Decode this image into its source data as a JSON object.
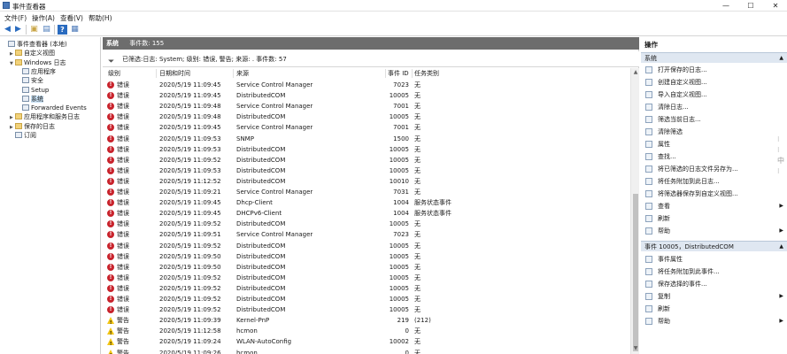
{
  "window": {
    "title": "事件查看器",
    "controls": {
      "minimize": "—",
      "maximize": "☐",
      "close": "✕"
    }
  },
  "menu": [
    "文件(F)",
    "操作(A)",
    "查看(V)",
    "帮助(H)"
  ],
  "toolbar": [
    "back-arrow-icon",
    "forward-arrow-icon",
    "up-folder-icon",
    "console-tree-icon",
    "help-icon",
    "properties-icon"
  ],
  "tree": [
    {
      "label": "事件查看器 (本地)",
      "indent": 0,
      "twisty": "",
      "icon": "computer"
    },
    {
      "label": "自定义视图",
      "indent": 1,
      "twisty": ">",
      "icon": "folder"
    },
    {
      "label": "Windows 日志",
      "indent": 1,
      "twisty": "v",
      "icon": "folder"
    },
    {
      "label": "应用程序",
      "indent": 2,
      "twisty": "",
      "icon": "log"
    },
    {
      "label": "安全",
      "indent": 2,
      "twisty": "",
      "icon": "log"
    },
    {
      "label": "Setup",
      "indent": 2,
      "twisty": "",
      "icon": "log"
    },
    {
      "label": "系统",
      "indent": 2,
      "twisty": "",
      "icon": "log",
      "selected": true
    },
    {
      "label": "Forwarded Events",
      "indent": 2,
      "twisty": "",
      "icon": "log"
    },
    {
      "label": "应用程序和服务日志",
      "indent": 1,
      "twisty": ">",
      "icon": "folder"
    },
    {
      "label": "保存的日志",
      "indent": 1,
      "twisty": ">",
      "icon": "folder"
    },
    {
      "label": "订阅",
      "indent": 1,
      "twisty": "",
      "icon": "log"
    }
  ],
  "center": {
    "log_name": "系统",
    "event_count": "事件数: 155",
    "filter_text": "已筛选:日志: System; 级别: 错误, 警告; 来源: . 事件数: 57",
    "columns": [
      "级别",
      "日期和时间",
      "来源",
      "事件 ID",
      "任务类别"
    ],
    "rows": [
      {
        "level": "错误",
        "type": "error",
        "datetime": "2020/5/19 11:09:45",
        "source": "Service Control Manager",
        "event_id": "7023",
        "task": "无"
      },
      {
        "level": "错误",
        "type": "error",
        "datetime": "2020/5/19 11:09:45",
        "source": "DistributedCOM",
        "event_id": "10005",
        "task": "无"
      },
      {
        "level": "错误",
        "type": "error",
        "datetime": "2020/5/19 11:09:48",
        "source": "Service Control Manager",
        "event_id": "7001",
        "task": "无"
      },
      {
        "level": "错误",
        "type": "error",
        "datetime": "2020/5/19 11:09:48",
        "source": "DistributedCOM",
        "event_id": "10005",
        "task": "无"
      },
      {
        "level": "错误",
        "type": "error",
        "datetime": "2020/5/19 11:09:45",
        "source": "Service Control Manager",
        "event_id": "7001",
        "task": "无"
      },
      {
        "level": "错误",
        "type": "error",
        "datetime": "2020/5/19 11:09:53",
        "source": "SNMP",
        "event_id": "1500",
        "task": "无"
      },
      {
        "level": "错误",
        "type": "error",
        "datetime": "2020/5/19 11:09:53",
        "source": "DistributedCOM",
        "event_id": "10005",
        "task": "无"
      },
      {
        "level": "错误",
        "type": "error",
        "datetime": "2020/5/19 11:09:52",
        "source": "DistributedCOM",
        "event_id": "10005",
        "task": "无"
      },
      {
        "level": "错误",
        "type": "error",
        "datetime": "2020/5/19 11:09:53",
        "source": "DistributedCOM",
        "event_id": "10005",
        "task": "无"
      },
      {
        "level": "错误",
        "type": "error",
        "datetime": "2020/5/19 11:12:52",
        "source": "DistributedCOM",
        "event_id": "10010",
        "task": "无"
      },
      {
        "level": "错误",
        "type": "error",
        "datetime": "2020/5/19 11:09:21",
        "source": "Service Control Manager",
        "event_id": "7031",
        "task": "无"
      },
      {
        "level": "错误",
        "type": "error",
        "datetime": "2020/5/19 11:09:45",
        "source": "Dhcp-Client",
        "event_id": "1004",
        "task": "服务状态事件"
      },
      {
        "level": "错误",
        "type": "error",
        "datetime": "2020/5/19 11:09:45",
        "source": "DHCPv6-Client",
        "event_id": "1004",
        "task": "服务状态事件"
      },
      {
        "level": "错误",
        "type": "error",
        "datetime": "2020/5/19 11:09:52",
        "source": "DistributedCOM",
        "event_id": "10005",
        "task": "无"
      },
      {
        "level": "错误",
        "type": "error",
        "datetime": "2020/5/19 11:09:51",
        "source": "Service Control Manager",
        "event_id": "7023",
        "task": "无"
      },
      {
        "level": "错误",
        "type": "error",
        "datetime": "2020/5/19 11:09:52",
        "source": "DistributedCOM",
        "event_id": "10005",
        "task": "无"
      },
      {
        "level": "错误",
        "type": "error",
        "datetime": "2020/5/19 11:09:50",
        "source": "DistributedCOM",
        "event_id": "10005",
        "task": "无"
      },
      {
        "level": "错误",
        "type": "error",
        "datetime": "2020/5/19 11:09:50",
        "source": "DistributedCOM",
        "event_id": "10005",
        "task": "无"
      },
      {
        "level": "错误",
        "type": "error",
        "datetime": "2020/5/19 11:09:52",
        "source": "DistributedCOM",
        "event_id": "10005",
        "task": "无"
      },
      {
        "level": "错误",
        "type": "error",
        "datetime": "2020/5/19 11:09:52",
        "source": "DistributedCOM",
        "event_id": "10005",
        "task": "无"
      },
      {
        "level": "错误",
        "type": "error",
        "datetime": "2020/5/19 11:09:52",
        "source": "DistributedCOM",
        "event_id": "10005",
        "task": "无"
      },
      {
        "level": "错误",
        "type": "error",
        "datetime": "2020/5/19 11:09:52",
        "source": "DistributedCOM",
        "event_id": "10005",
        "task": "无"
      },
      {
        "level": "警告",
        "type": "warning",
        "datetime": "2020/5/19 11:09:39",
        "source": "Kernel-PnP",
        "event_id": "219",
        "task": "(212)"
      },
      {
        "level": "警告",
        "type": "warning",
        "datetime": "2020/5/19 11:12:58",
        "source": "hcmon",
        "event_id": "0",
        "task": "无"
      },
      {
        "level": "警告",
        "type": "warning",
        "datetime": "2020/5/19 11:09:24",
        "source": "WLAN-AutoConfig",
        "event_id": "10002",
        "task": "无"
      },
      {
        "level": "警告",
        "type": "warning",
        "datetime": "2020/5/19 11:09:26",
        "source": "hcmon",
        "event_id": "0",
        "task": "无"
      }
    ]
  },
  "actions": {
    "title": "操作",
    "section1": "系统",
    "section1_items": [
      {
        "label": "打开保存的日志...",
        "icon": "open-log-icon"
      },
      {
        "label": "创建自定义视图...",
        "icon": "filter-create-icon"
      },
      {
        "label": "导入自定义视图...",
        "icon": "import-icon"
      },
      {
        "label": "清除日志...",
        "icon": "clear-log-icon"
      },
      {
        "label": "筛选当前日志...",
        "icon": "filter-icon"
      },
      {
        "label": "清除筛选",
        "icon": "clear-filter-icon"
      },
      {
        "label": "属性",
        "icon": "properties-icon"
      },
      {
        "label": "查找...",
        "icon": "find-icon"
      },
      {
        "label": "将已筛选的日志文件另存为...",
        "icon": "save-icon"
      },
      {
        "label": "将任务附加到此日志...",
        "icon": "attach-task-icon"
      },
      {
        "label": "将筛选器保存到自定义视图...",
        "icon": "save-filter-icon"
      },
      {
        "label": "查看",
        "icon": "view-icon",
        "submenu": true
      },
      {
        "label": "刷新",
        "icon": "refresh-icon"
      },
      {
        "label": "帮助",
        "icon": "help-icon",
        "submenu": true
      }
    ],
    "section2": "事件 10005，DistributedCOM",
    "section2_items": [
      {
        "label": "事件属性",
        "icon": "event-properties-icon"
      },
      {
        "label": "将任务附加到此事件...",
        "icon": "attach-task-icon"
      },
      {
        "label": "保存选择的事件...",
        "icon": "save-icon"
      },
      {
        "label": "复制",
        "icon": "copy-icon",
        "submenu": true
      },
      {
        "label": "刷新",
        "icon": "refresh-icon"
      },
      {
        "label": "帮助",
        "icon": "help-icon",
        "submenu": true
      }
    ]
  },
  "colors": {
    "header_gray": "#6d6d6d",
    "section_blue": "#dfe7f1",
    "error_red": "#c8232c",
    "warning_yellow": "#f3c614",
    "selection": "#cce4f7"
  }
}
